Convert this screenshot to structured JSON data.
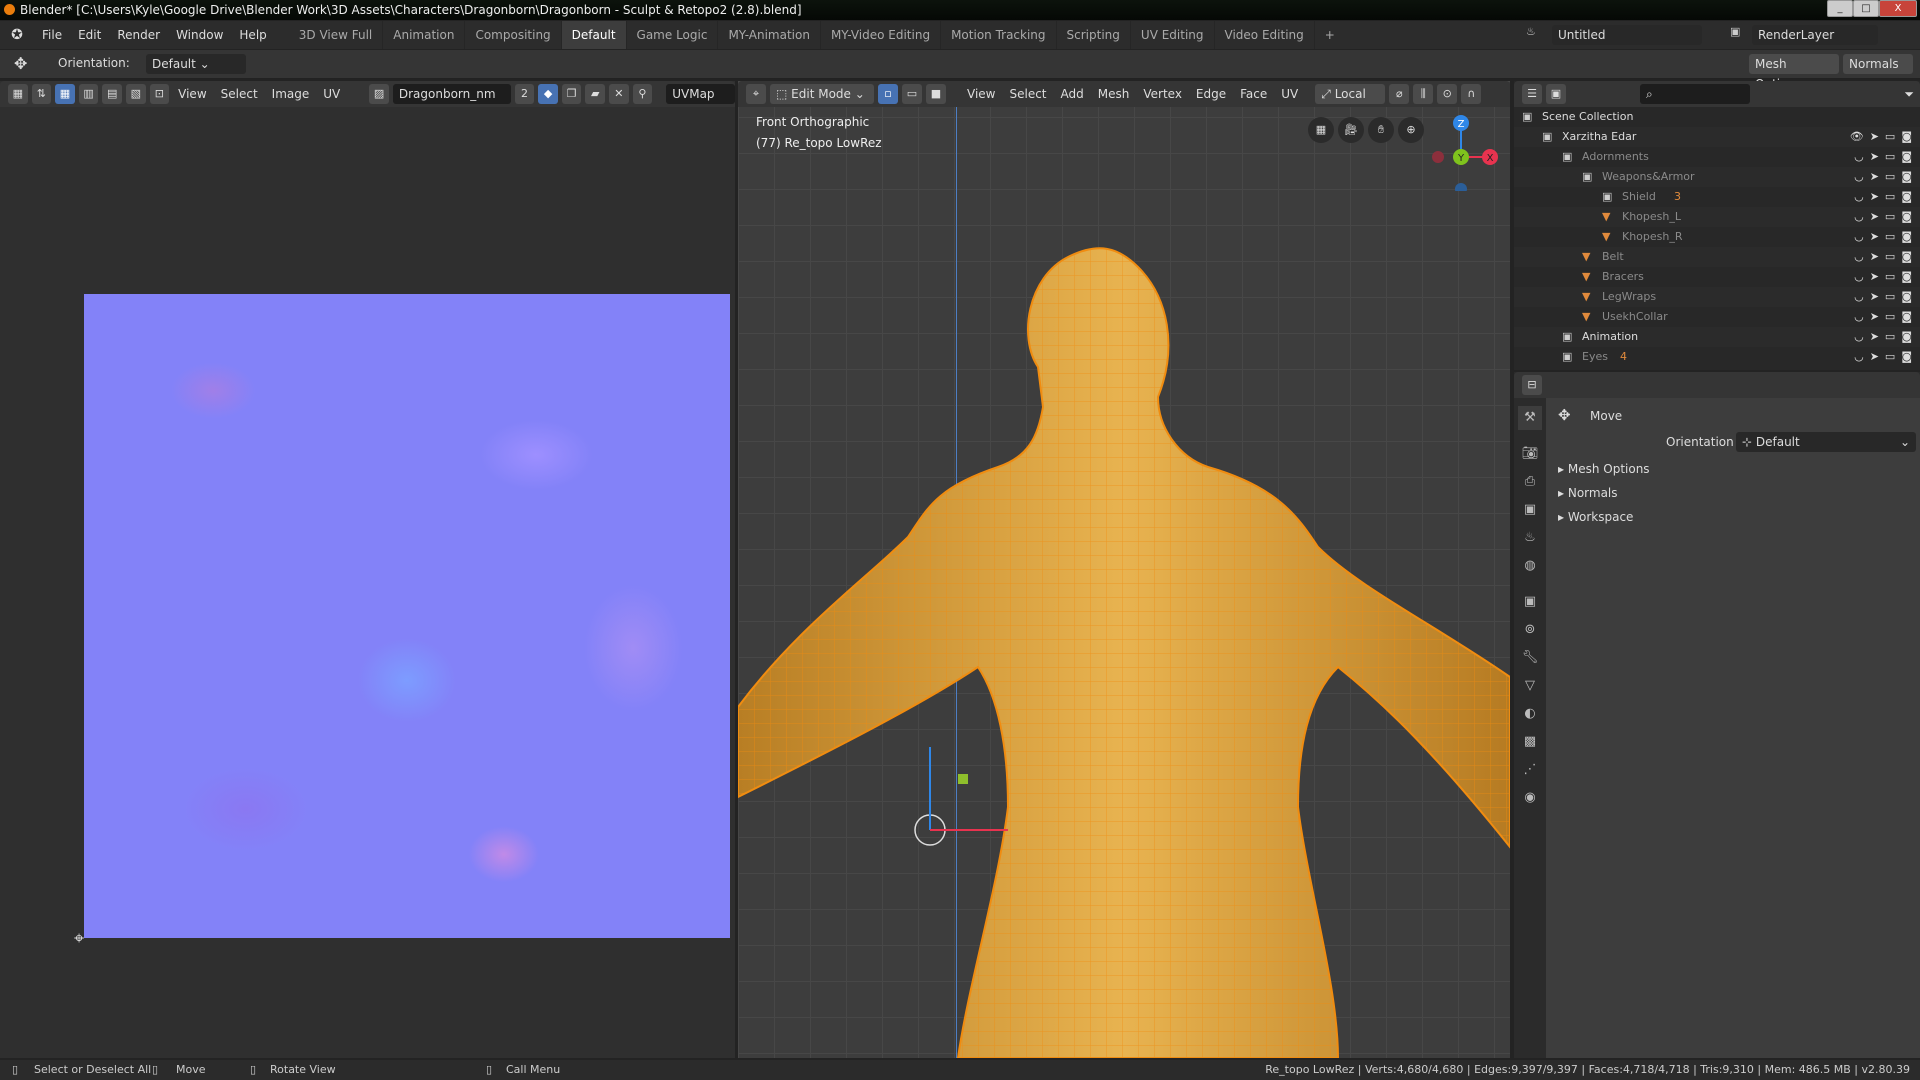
{
  "window": {
    "title": "Blender* [C:\\Users\\Kyle\\Google Drive\\Blender Work\\3D Assets\\Characters\\Dragonborn\\Dragonborn - Sculpt & Retopo2 (2.8).blend]",
    "minimize": "_",
    "maximize": "□",
    "close": "X"
  },
  "menubar": {
    "items": [
      "File",
      "Edit",
      "Render",
      "Window",
      "Help"
    ],
    "workspaces": [
      "3D View Full",
      "Animation",
      "Compositing",
      "Default",
      "Game Logic",
      "MY-Animation",
      "MY-Video Editing",
      "Motion Tracking",
      "Scripting",
      "UV Editing",
      "Video Editing",
      "+"
    ],
    "active_workspace": "Default",
    "scene": "Untitled",
    "view_layer": "RenderLayer"
  },
  "toolheader": {
    "orientation_label": "Orientation:",
    "orientation_value": "Default",
    "mesh_options": "Mesh Options",
    "normals": "Normals"
  },
  "uv_editor": {
    "menus": [
      "View",
      "Select",
      "Image",
      "UV"
    ],
    "image_name": "Dragonborn_nm",
    "users": "2",
    "uv_map": "UVMap"
  },
  "viewport": {
    "mode": "Edit Mode",
    "menus": [
      "View",
      "Select",
      "Add",
      "Mesh",
      "Vertex",
      "Edge",
      "Face",
      "UV"
    ],
    "transform_orientation": "Local",
    "view_name": "Front Orthographic",
    "object_info": "(77) Re_topo LowRez",
    "gizmo": {
      "x": "X",
      "y": "Y",
      "z": "Z",
      "x_color": "#e8334f",
      "y_color": "#7fc31d",
      "z_color": "#2f87e8"
    },
    "mesh_color": "#e8921c"
  },
  "outliner": {
    "rows": [
      {
        "label": "Scene Collection",
        "depth": 0,
        "type": "collection"
      },
      {
        "label": "Xarzitha Edar",
        "depth": 1,
        "type": "collection"
      },
      {
        "label": "Adornments",
        "depth": 2,
        "type": "collection"
      },
      {
        "label": "Weapons&Armor",
        "depth": 3,
        "type": "collection"
      },
      {
        "label": "Shield",
        "depth": 4,
        "type": "collection",
        "badge": "3"
      },
      {
        "label": "Khopesh_L",
        "depth": 4,
        "type": "mesh"
      },
      {
        "label": "Khopesh_R",
        "depth": 4,
        "type": "mesh"
      },
      {
        "label": "Belt",
        "depth": 3,
        "type": "mesh"
      },
      {
        "label": "Bracers",
        "depth": 3,
        "type": "mesh"
      },
      {
        "label": "LegWraps",
        "depth": 3,
        "type": "mesh"
      },
      {
        "label": "UsekhCollar",
        "depth": 3,
        "type": "mesh"
      },
      {
        "label": "Animation",
        "depth": 2,
        "type": "collection"
      },
      {
        "label": "Eyes",
        "depth": 2,
        "type": "collection",
        "badge": "4"
      }
    ]
  },
  "properties": {
    "tool": "Move",
    "orientation_label": "Orientation",
    "orientation_value": "Default",
    "panels": [
      "Mesh Options",
      "Normals",
      "Workspace"
    ]
  },
  "statusbar": {
    "hints": [
      "Select or Deselect All",
      "Move",
      "Rotate View",
      "Call Menu"
    ],
    "stats": "Re_topo LowRez | Verts:4,680/4,680 | Edges:9,397/9,397 | Faces:4,718/4,718 | Tris:9,310 | Mem: 486.5 MB | v2.80.39"
  }
}
